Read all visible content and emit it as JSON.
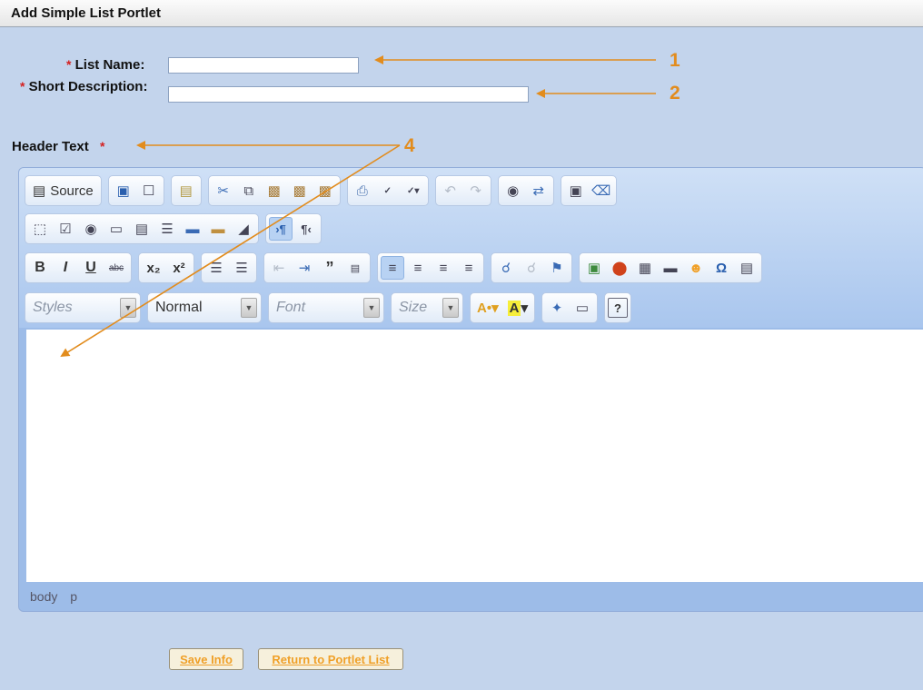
{
  "window": {
    "title": "Add Simple List Portlet"
  },
  "form": {
    "required_mark": "*",
    "list_name": {
      "label": "List Name:",
      "value": ""
    },
    "short_description": {
      "label": "Short Description:",
      "value": ""
    },
    "header_text": {
      "label": "Header Text"
    }
  },
  "editor": {
    "toolbar": {
      "source_label": "Source",
      "styles_placeholder": "Styles",
      "format_value": "Normal",
      "font_placeholder": "Font",
      "size_placeholder": "Size"
    },
    "status_path": [
      "body",
      "p"
    ]
  },
  "buttons": {
    "save": "Save Info",
    "return": "Return to Portlet List"
  },
  "annotations": [
    "1",
    "2",
    "4"
  ],
  "colors": {
    "background": "#c3d4ec",
    "annotation": "#e28c1d",
    "required": "#d42020",
    "button_text": "#f0a028"
  }
}
